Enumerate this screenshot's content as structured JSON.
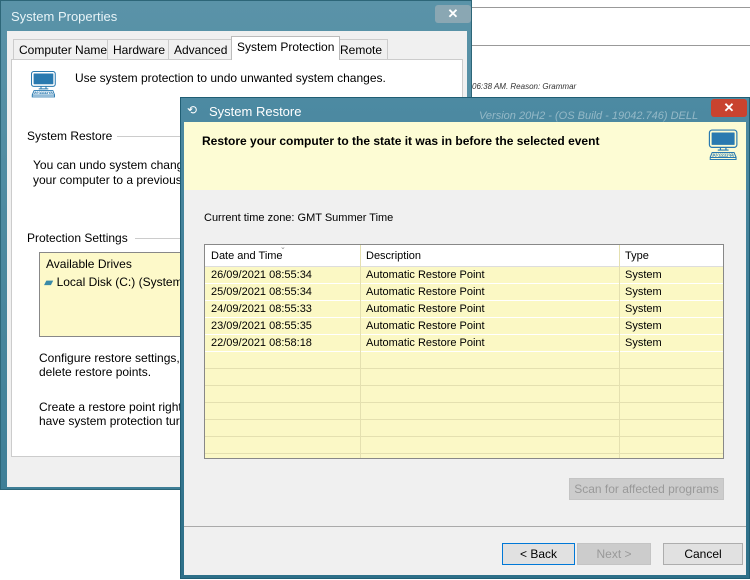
{
  "background": {
    "note_text": "06:38 AM. Reason: Grammar",
    "faded_text": "Version 20H2 - (OS Build - 19042.746) DELL"
  },
  "system_properties": {
    "title": "System Properties",
    "tabs": [
      "Computer Name",
      "Hardware",
      "Advanced",
      "System Protection",
      "Remote"
    ],
    "active_tab": "System Protection",
    "intro": "Use system protection to undo unwanted system changes.",
    "restore_group": "System Restore",
    "restore_text": [
      "You can undo system change",
      "your computer to a previous r"
    ],
    "protection_group": "Protection Settings",
    "drives_header": "Available Drives",
    "drive": "Local Disk (C:) (System",
    "configure_text": [
      "Configure restore settings, m",
      "delete restore points."
    ],
    "create_text": [
      "Create a restore point right r",
      "have system protection turn"
    ]
  },
  "system_restore": {
    "title": "System Restore",
    "heading": "Restore your computer to the state it was in before the selected event",
    "timezone": "Current time zone: GMT Summer Time",
    "columns": [
      "Date and Time",
      "Description",
      "Type"
    ],
    "rows": [
      [
        "26/09/2021 08:55:34",
        "Automatic Restore Point",
        "System"
      ],
      [
        "25/09/2021 08:55:34",
        "Automatic Restore Point",
        "System"
      ],
      [
        "24/09/2021 08:55:33",
        "Automatic Restore Point",
        "System"
      ],
      [
        "23/09/2021 08:55:35",
        "Automatic Restore Point",
        "System"
      ],
      [
        "22/09/2021 08:58:18",
        "Automatic Restore Point",
        "System"
      ]
    ],
    "scan_button": "Scan for affected programs",
    "back_button": "< Back",
    "next_button": "Next >",
    "cancel_button": "Cancel"
  }
}
